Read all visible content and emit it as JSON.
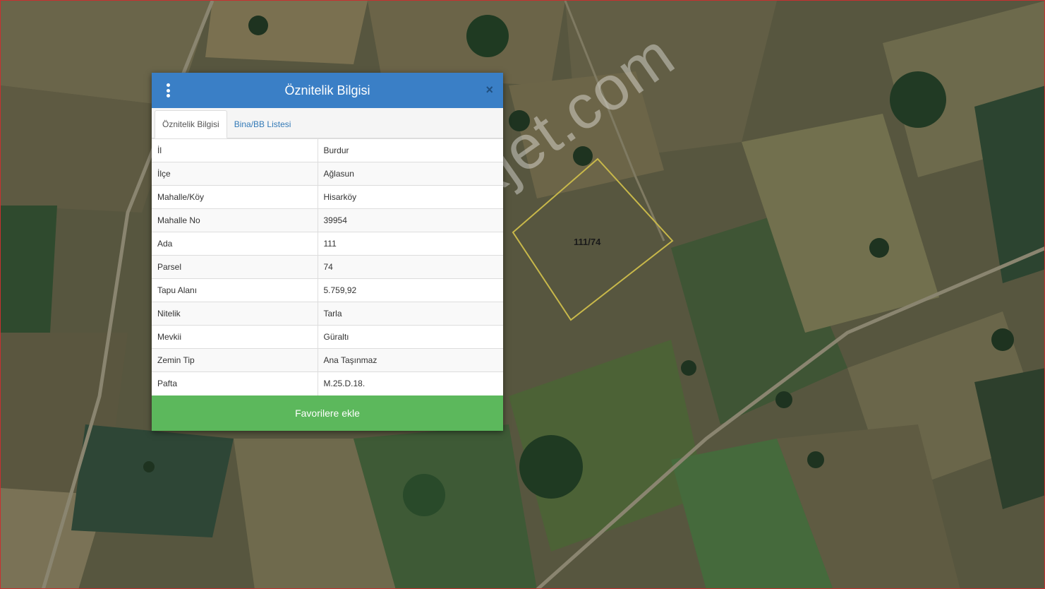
{
  "map": {
    "parcel_label": "111/74",
    "watermark": "emlakjet.com"
  },
  "panel": {
    "title": "Öznitelik Bilgisi",
    "close_glyph": "×",
    "tabs": [
      {
        "label": "Öznitelik Bilgisi",
        "active": true
      },
      {
        "label": "Bina/BB Listesi",
        "active": false
      }
    ],
    "rows": [
      {
        "key": "İl",
        "value": "Burdur"
      },
      {
        "key": "İlçe",
        "value": "Ağlasun"
      },
      {
        "key": "Mahalle/Köy",
        "value": "Hisarköy"
      },
      {
        "key": "Mahalle No",
        "value": "39954"
      },
      {
        "key": "Ada",
        "value": "111"
      },
      {
        "key": "Parsel",
        "value": "74"
      },
      {
        "key": "Tapu Alanı",
        "value": "5.759,92"
      },
      {
        "key": "Nitelik",
        "value": "Tarla"
      },
      {
        "key": "Mevkii",
        "value": "Güraltı"
      },
      {
        "key": "Zemin Tip",
        "value": "Ana Taşınmaz"
      },
      {
        "key": "Pafta",
        "value": "M.25.D.18."
      }
    ],
    "favorite_button": "Favorilere ekle"
  },
  "colors": {
    "header": "#3a7fc6",
    "favorite_button": "#5cb85c",
    "tab_link": "#337ab7",
    "parcel_outline": "#c8b84a"
  },
  "icons": {
    "menu": "vertical-dots-icon",
    "close": "close-icon"
  }
}
